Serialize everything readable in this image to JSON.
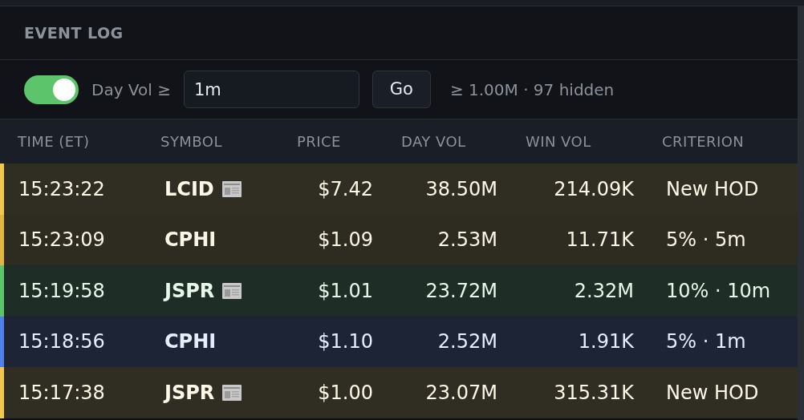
{
  "panel": {
    "title": "EVENT LOG"
  },
  "filter": {
    "on": true,
    "label": "Day Vol ≥",
    "value": "1m",
    "button": "Go",
    "summary": "≥ 1.00M · 97 hidden"
  },
  "table": {
    "columns": [
      "TIME (ET)",
      "SYMBOL",
      "PRICE",
      "DAY VOL",
      "WIN VOL",
      "CRITERION"
    ],
    "rows": [
      {
        "time": "15:23:22",
        "symbol": "LCID",
        "news": true,
        "price": "$7.42",
        "day_vol": "38.50M",
        "win_vol": "214.09K",
        "criterion": "New HOD",
        "color": "#f2c94c"
      },
      {
        "time": "15:23:09",
        "symbol": "CPHI",
        "news": false,
        "price": "$1.09",
        "day_vol": "2.53M",
        "win_vol": "11.71K",
        "criterion": "5% · 5m",
        "color": "#e2b440"
      },
      {
        "time": "15:19:58",
        "symbol": "JSPR",
        "news": true,
        "price": "$1.01",
        "day_vol": "23.72M",
        "win_vol": "2.32M",
        "criterion": "10% · 10m",
        "color": "#5cc46a"
      },
      {
        "time": "15:18:56",
        "symbol": "CPHI",
        "news": false,
        "price": "$1.10",
        "day_vol": "2.52M",
        "win_vol": "1.91K",
        "criterion": "5% · 1m",
        "color": "#4f80ea"
      },
      {
        "time": "15:17:38",
        "symbol": "JSPR",
        "news": true,
        "price": "$1.00",
        "day_vol": "23.07M",
        "win_vol": "315.31K",
        "criterion": "New HOD",
        "color": "#f2c94c"
      }
    ]
  }
}
